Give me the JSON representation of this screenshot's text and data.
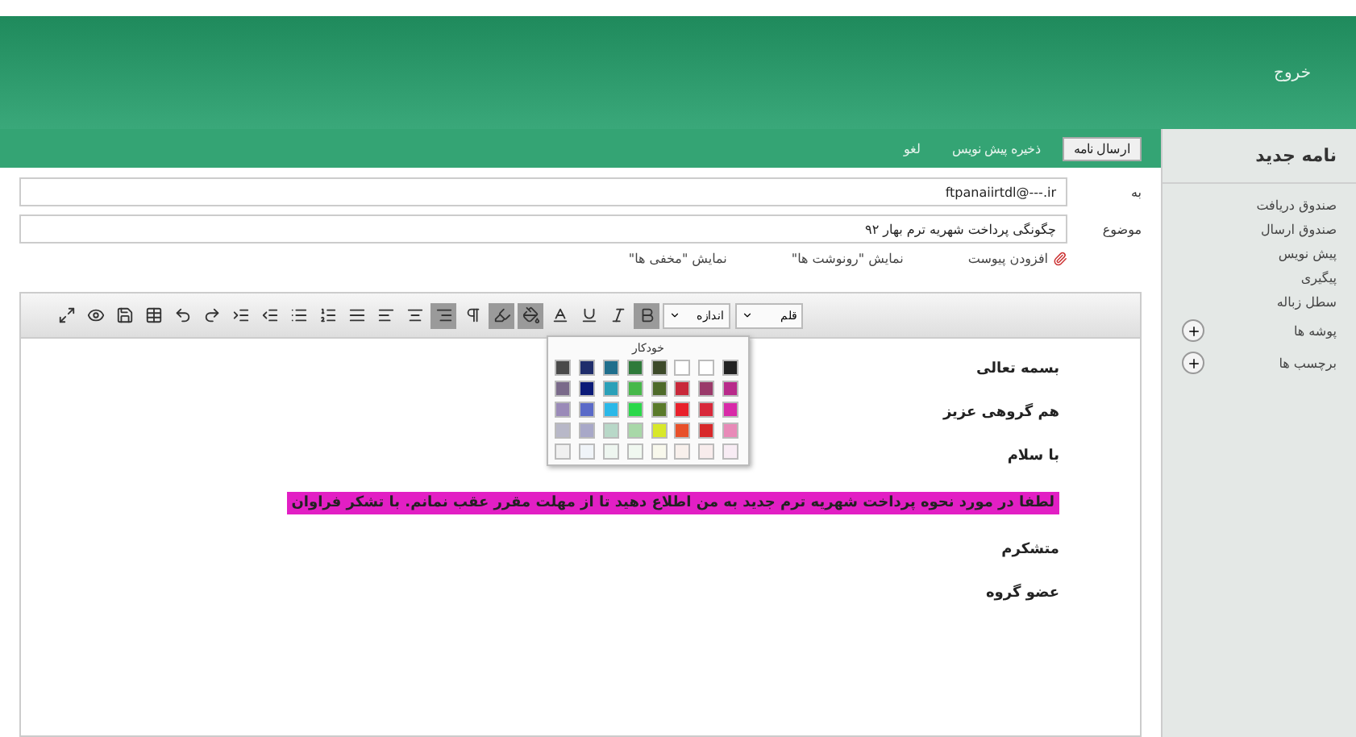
{
  "header": {
    "link": "خروج"
  },
  "actions": [
    {
      "label": "ارسال نامه",
      "primary": true
    },
    {
      "label": "ذخیره پیش نویس",
      "primary": false
    },
    {
      "label": "لغو",
      "primary": false
    }
  ],
  "sidebar": {
    "title": "نامه جدید",
    "items": [
      {
        "label": "صندوق دریافت",
        "expandable": false
      },
      {
        "label": "صندوق ارسال",
        "expandable": false
      },
      {
        "label": "پیش نویس",
        "expandable": false
      },
      {
        "label": "پیگیری",
        "expandable": false
      },
      {
        "label": "سطل زباله",
        "expandable": false
      },
      {
        "label": "پوشه ها",
        "expandable": true
      },
      {
        "label": "برچسب ها",
        "expandable": true
      }
    ]
  },
  "to": {
    "label": "به",
    "value": "ftpanaiirtdl@---.ir"
  },
  "subject": {
    "label": "موضوع",
    "value": "چگونگی پرداخت شهریه ترم بهار ۹۲"
  },
  "options": [
    {
      "kind": "attach",
      "label": "افزودن پیوست"
    },
    {
      "kind": "link",
      "label": "نمایش \"رونوشت ها\""
    },
    {
      "kind": "link",
      "label": "نمایش \"مخفی ها\""
    }
  ],
  "toolbar": [
    {
      "kind": "maximize",
      "pressed": false
    },
    {
      "kind": "preview",
      "pressed": false
    },
    {
      "kind": "save",
      "pressed": false
    },
    {
      "kind": "table",
      "pressed": false
    },
    {
      "kind": "undo",
      "pressed": false
    },
    {
      "kind": "redo",
      "pressed": false
    },
    {
      "kind": "indent",
      "pressed": false
    },
    {
      "kind": "outdent",
      "pressed": false
    },
    {
      "kind": "bullet",
      "pressed": false
    },
    {
      "kind": "number",
      "pressed": false
    },
    {
      "kind": "justify",
      "pressed": false
    },
    {
      "kind": "align-left",
      "pressed": false
    },
    {
      "kind": "align-center",
      "pressed": false
    },
    {
      "kind": "align-right",
      "pressed": true
    },
    {
      "kind": "direction",
      "pressed": false
    },
    {
      "kind": "highlight",
      "pressed": true
    },
    {
      "kind": "color",
      "pressed": true
    },
    {
      "kind": "text-color",
      "pressed": false
    },
    {
      "kind": "underline",
      "pressed": false
    },
    {
      "kind": "italic",
      "pressed": false
    },
    {
      "kind": "bold",
      "pressed": true
    }
  ],
  "dropdowns": [
    {
      "label": "قلم"
    },
    {
      "label": "اندازه"
    }
  ],
  "palette": {
    "title": "خودکار",
    "colors": [
      {
        "color": "#4a4a4a"
      },
      {
        "color": "#1f2d6b"
      },
      {
        "color": "#1f6e8c"
      },
      {
        "color": "#2e7a3a"
      },
      {
        "color": "#3d4a2a"
      },
      {
        "color": "#ffffff"
      },
      {
        "color": "#ffffff"
      },
      {
        "color": "#222222"
      },
      {
        "color": "#7a6a8a"
      },
      {
        "color": "#0b1a78"
      },
      {
        "color": "#2aa0b8"
      },
      {
        "color": "#46b84a"
      },
      {
        "color": "#4e6a2a"
      },
      {
        "color": "#c8283a"
      },
      {
        "color": "#9a3a6a"
      },
      {
        "color": "#b82a8a"
      },
      {
        "color": "#9a8ab8"
      },
      {
        "color": "#5a6ac8"
      },
      {
        "color": "#2ab8e8"
      },
      {
        "color": "#2ad84a"
      },
      {
        "color": "#5a7a2a"
      },
      {
        "color": "#e8202a"
      },
      {
        "color": "#d8283a"
      },
      {
        "color": "#d82aa8"
      },
      {
        "color": "#b8b8c8"
      },
      {
        "color": "#a8a8c8"
      },
      {
        "color": "#b8d8c8"
      },
      {
        "color": "#a8d8a8"
      },
      {
        "color": "#d8e82a"
      },
      {
        "color": "#e8502a"
      },
      {
        "color": "#d8282a"
      },
      {
        "color": "#e88ab8"
      },
      {
        "color": "#f0f0f0"
      },
      {
        "color": "#f0f4f8"
      },
      {
        "color": "#eef6f0"
      },
      {
        "color": "#f0f8f0"
      },
      {
        "color": "#f8f8ec"
      },
      {
        "color": "#f8f0ec"
      },
      {
        "color": "#f8ecec"
      },
      {
        "color": "#f8ecf4"
      }
    ]
  },
  "body": [
    {
      "text": "بسمه تعالی",
      "highlighted": false
    },
    {
      "text": "هم گروهی عزیز",
      "highlighted": false
    },
    {
      "text": "با سلام",
      "highlighted": false
    },
    {
      "text": "لطفا در مورد نحوه پرداخت شهریه ترم جدید به من اطلاع دهید تا از مهلت مقرر عقب نمانم. با تشکر فراوان",
      "highlighted": true
    },
    {
      "text": "متشکرم",
      "highlighted": false
    },
    {
      "text": "عضو گروه",
      "highlighted": false
    }
  ]
}
